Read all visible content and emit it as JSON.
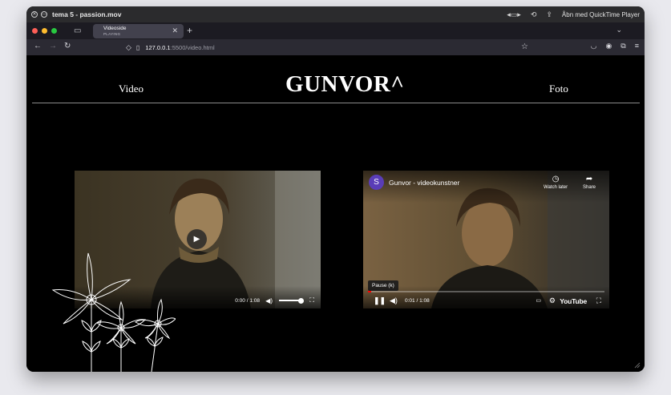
{
  "quicktime_bar": {
    "title": "tema 5 - passion.mov",
    "open_with": "Åbn med QuickTime Player",
    "icons": [
      "close-icon",
      "minimize-icon",
      "resize-icon",
      "rotate-icon",
      "share-icon"
    ]
  },
  "browser": {
    "tab": {
      "title": "Videoside",
      "subtitle": "PLAYING"
    },
    "url": {
      "host": "127.0.0.1",
      "rest": ":5500/video.html"
    },
    "light_colors": [
      "#fe5f57",
      "#febc2e",
      "#28c840"
    ]
  },
  "site": {
    "nav_left": "Video",
    "logo": "GUNVOR^",
    "nav_right": "Foto"
  },
  "video_local": {
    "time": "0:00 / 1:08",
    "progress": 0,
    "volume": 1
  },
  "video_youtube": {
    "channel_initial": "S",
    "title": "Gunvor - videokunstner",
    "watch_later": "Watch later",
    "share": "Share",
    "tooltip": "Pause (k)",
    "time": "0:01 / 1:08",
    "progress": 0.015,
    "logo": "YouTube"
  }
}
